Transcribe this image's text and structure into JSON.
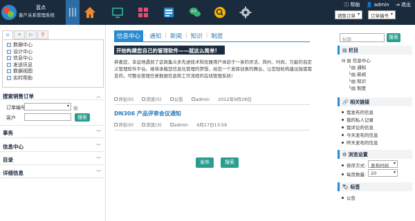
{
  "header": {
    "logo_name": "蓝点",
    "logo_subtitle": "客户关系管理系统",
    "menu_toggle": "|||",
    "links": {
      "help": "帮助",
      "user": "admin",
      "logout": "退出"
    },
    "selects": {
      "order_type": "销售订单",
      "order_no": "订单编号"
    }
  },
  "left": {
    "tabs": [
      "⌂",
      "+",
      "▷",
      "⚲"
    ],
    "tree": [
      "数据中心",
      "设计中心",
      "信息中心",
      "发送讯息",
      "数据视图",
      "实时帮助"
    ],
    "search_section": {
      "title": "搜索销售订单",
      "order_no_label": "订单编号",
      "customer_label": "客户",
      "checkbox_label": "模",
      "search_button": "搜索"
    },
    "sections": [
      "事务",
      "信息中心",
      "目录",
      "详细信息"
    ]
  },
  "main": {
    "tabs": [
      "信息中心",
      "通知",
      "新闻",
      "知识",
      "制度"
    ],
    "article1": {
      "title": "开始构建您自己的管理软件——就这么简单!",
      "body": "恭喜您，幸运地遇到了这款集众多先进技术和优雅用户体验于一身的灵活、简约、时尚、万能的自定义管理软件平台。她将承载您信息化管理的梦想，给您一个发挥创意的舞台，让您轻松构建出独需需变的，可整合管理任意数据信息和工作流程的在线管理系统!",
      "comments": "评论(0)",
      "views": "浏览(5)",
      "tag": "公告",
      "author": "admin",
      "date": "2012年9月28日"
    },
    "article2": {
      "title": "DN306 产品评审会议通知",
      "comments": "评论(0)",
      "views": "浏览(3)",
      "author": "admin",
      "date": "4月17日13:59"
    },
    "buttons": {
      "publish": "发布",
      "search": "搜索"
    }
  },
  "right": {
    "search": {
      "placeholder": "标题",
      "button": "搜索"
    },
    "columns": {
      "title": "栏目",
      "root": "信息中心",
      "children": [
        "通知",
        "新闻",
        "知识",
        "制度"
      ]
    },
    "related": {
      "title": "相关链接",
      "items": [
        "我发布的信息",
        "我的私人记录",
        "我评论的信息",
        "今天发布的信息",
        "昨天发布的信息"
      ]
    },
    "browse": {
      "title": "浏览设置",
      "sort_label": "排序方式:",
      "sort_value": "发布时间",
      "page_label": "每页数量:",
      "page_value": "20"
    },
    "tags": {
      "title": "标签",
      "items": [
        "公告"
      ]
    }
  },
  "colors": {
    "topbar": "#1b2b3e",
    "accent": "#2a8bd0",
    "button": "#2a9d8f"
  }
}
